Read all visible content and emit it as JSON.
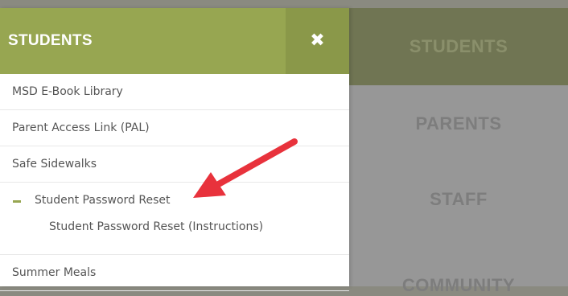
{
  "background_nav": {
    "tiles": [
      "STUDENTS",
      "PARENTS",
      "STAFF",
      "COMMUNITY"
    ]
  },
  "panel": {
    "title": "STUDENTS",
    "close_icon": "close-icon",
    "items": [
      {
        "label": "MSD E-Book Library"
      },
      {
        "label": "Parent Access Link (PAL)"
      },
      {
        "label": "Safe Sidewalks"
      },
      {
        "label": "Student Password Reset",
        "expanded": true,
        "subitems": [
          {
            "label": "Student Password Reset (Instructions)"
          }
        ]
      },
      {
        "label": "Summer Meals"
      }
    ]
  },
  "colors": {
    "accent": "#97a651",
    "accent_dark": "#8a9849",
    "annotation_arrow": "#e8323c"
  }
}
